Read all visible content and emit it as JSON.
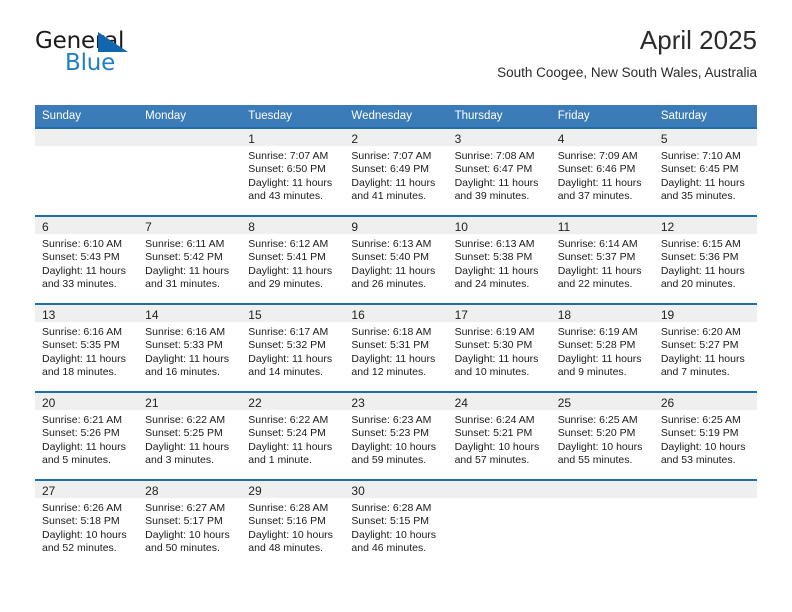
{
  "brand": {
    "name_top": "General",
    "name_bottom": "Blue",
    "triangle_color": "#1266ae",
    "blue_color": "#1f7fc4"
  },
  "header": {
    "title": "April 2025",
    "subtitle": "South Coogee, New South Wales, Australia"
  },
  "theme": {
    "header_row_bg": "#3b7cb8",
    "row_divider": "#1f6cb0",
    "daynum_band_bg": "#efefef"
  },
  "calendar": {
    "weekdays": [
      "Sunday",
      "Monday",
      "Tuesday",
      "Wednesday",
      "Thursday",
      "Friday",
      "Saturday"
    ],
    "weeks": [
      [
        {
          "day": "",
          "sunrise": "",
          "sunset": "",
          "daylight1": "",
          "daylight2": ""
        },
        {
          "day": "",
          "sunrise": "",
          "sunset": "",
          "daylight1": "",
          "daylight2": ""
        },
        {
          "day": "1",
          "sunrise": "Sunrise: 7:07 AM",
          "sunset": "Sunset: 6:50 PM",
          "daylight1": "Daylight: 11 hours",
          "daylight2": "and 43 minutes."
        },
        {
          "day": "2",
          "sunrise": "Sunrise: 7:07 AM",
          "sunset": "Sunset: 6:49 PM",
          "daylight1": "Daylight: 11 hours",
          "daylight2": "and 41 minutes."
        },
        {
          "day": "3",
          "sunrise": "Sunrise: 7:08 AM",
          "sunset": "Sunset: 6:47 PM",
          "daylight1": "Daylight: 11 hours",
          "daylight2": "and 39 minutes."
        },
        {
          "day": "4",
          "sunrise": "Sunrise: 7:09 AM",
          "sunset": "Sunset: 6:46 PM",
          "daylight1": "Daylight: 11 hours",
          "daylight2": "and 37 minutes."
        },
        {
          "day": "5",
          "sunrise": "Sunrise: 7:10 AM",
          "sunset": "Sunset: 6:45 PM",
          "daylight1": "Daylight: 11 hours",
          "daylight2": "and 35 minutes."
        }
      ],
      [
        {
          "day": "6",
          "sunrise": "Sunrise: 6:10 AM",
          "sunset": "Sunset: 5:43 PM",
          "daylight1": "Daylight: 11 hours",
          "daylight2": "and 33 minutes."
        },
        {
          "day": "7",
          "sunrise": "Sunrise: 6:11 AM",
          "sunset": "Sunset: 5:42 PM",
          "daylight1": "Daylight: 11 hours",
          "daylight2": "and 31 minutes."
        },
        {
          "day": "8",
          "sunrise": "Sunrise: 6:12 AM",
          "sunset": "Sunset: 5:41 PM",
          "daylight1": "Daylight: 11 hours",
          "daylight2": "and 29 minutes."
        },
        {
          "day": "9",
          "sunrise": "Sunrise: 6:13 AM",
          "sunset": "Sunset: 5:40 PM",
          "daylight1": "Daylight: 11 hours",
          "daylight2": "and 26 minutes."
        },
        {
          "day": "10",
          "sunrise": "Sunrise: 6:13 AM",
          "sunset": "Sunset: 5:38 PM",
          "daylight1": "Daylight: 11 hours",
          "daylight2": "and 24 minutes."
        },
        {
          "day": "11",
          "sunrise": "Sunrise: 6:14 AM",
          "sunset": "Sunset: 5:37 PM",
          "daylight1": "Daylight: 11 hours",
          "daylight2": "and 22 minutes."
        },
        {
          "day": "12",
          "sunrise": "Sunrise: 6:15 AM",
          "sunset": "Sunset: 5:36 PM",
          "daylight1": "Daylight: 11 hours",
          "daylight2": "and 20 minutes."
        }
      ],
      [
        {
          "day": "13",
          "sunrise": "Sunrise: 6:16 AM",
          "sunset": "Sunset: 5:35 PM",
          "daylight1": "Daylight: 11 hours",
          "daylight2": "and 18 minutes."
        },
        {
          "day": "14",
          "sunrise": "Sunrise: 6:16 AM",
          "sunset": "Sunset: 5:33 PM",
          "daylight1": "Daylight: 11 hours",
          "daylight2": "and 16 minutes."
        },
        {
          "day": "15",
          "sunrise": "Sunrise: 6:17 AM",
          "sunset": "Sunset: 5:32 PM",
          "daylight1": "Daylight: 11 hours",
          "daylight2": "and 14 minutes."
        },
        {
          "day": "16",
          "sunrise": "Sunrise: 6:18 AM",
          "sunset": "Sunset: 5:31 PM",
          "daylight1": "Daylight: 11 hours",
          "daylight2": "and 12 minutes."
        },
        {
          "day": "17",
          "sunrise": "Sunrise: 6:19 AM",
          "sunset": "Sunset: 5:30 PM",
          "daylight1": "Daylight: 11 hours",
          "daylight2": "and 10 minutes."
        },
        {
          "day": "18",
          "sunrise": "Sunrise: 6:19 AM",
          "sunset": "Sunset: 5:28 PM",
          "daylight1": "Daylight: 11 hours",
          "daylight2": "and 9 minutes."
        },
        {
          "day": "19",
          "sunrise": "Sunrise: 6:20 AM",
          "sunset": "Sunset: 5:27 PM",
          "daylight1": "Daylight: 11 hours",
          "daylight2": "and 7 minutes."
        }
      ],
      [
        {
          "day": "20",
          "sunrise": "Sunrise: 6:21 AM",
          "sunset": "Sunset: 5:26 PM",
          "daylight1": "Daylight: 11 hours",
          "daylight2": "and 5 minutes."
        },
        {
          "day": "21",
          "sunrise": "Sunrise: 6:22 AM",
          "sunset": "Sunset: 5:25 PM",
          "daylight1": "Daylight: 11 hours",
          "daylight2": "and 3 minutes."
        },
        {
          "day": "22",
          "sunrise": "Sunrise: 6:22 AM",
          "sunset": "Sunset: 5:24 PM",
          "daylight1": "Daylight: 11 hours",
          "daylight2": "and 1 minute."
        },
        {
          "day": "23",
          "sunrise": "Sunrise: 6:23 AM",
          "sunset": "Sunset: 5:23 PM",
          "daylight1": "Daylight: 10 hours",
          "daylight2": "and 59 minutes."
        },
        {
          "day": "24",
          "sunrise": "Sunrise: 6:24 AM",
          "sunset": "Sunset: 5:21 PM",
          "daylight1": "Daylight: 10 hours",
          "daylight2": "and 57 minutes."
        },
        {
          "day": "25",
          "sunrise": "Sunrise: 6:25 AM",
          "sunset": "Sunset: 5:20 PM",
          "daylight1": "Daylight: 10 hours",
          "daylight2": "and 55 minutes."
        },
        {
          "day": "26",
          "sunrise": "Sunrise: 6:25 AM",
          "sunset": "Sunset: 5:19 PM",
          "daylight1": "Daylight: 10 hours",
          "daylight2": "and 53 minutes."
        }
      ],
      [
        {
          "day": "27",
          "sunrise": "Sunrise: 6:26 AM",
          "sunset": "Sunset: 5:18 PM",
          "daylight1": "Daylight: 10 hours",
          "daylight2": "and 52 minutes."
        },
        {
          "day": "28",
          "sunrise": "Sunrise: 6:27 AM",
          "sunset": "Sunset: 5:17 PM",
          "daylight1": "Daylight: 10 hours",
          "daylight2": "and 50 minutes."
        },
        {
          "day": "29",
          "sunrise": "Sunrise: 6:28 AM",
          "sunset": "Sunset: 5:16 PM",
          "daylight1": "Daylight: 10 hours",
          "daylight2": "and 48 minutes."
        },
        {
          "day": "30",
          "sunrise": "Sunrise: 6:28 AM",
          "sunset": "Sunset: 5:15 PM",
          "daylight1": "Daylight: 10 hours",
          "daylight2": "and 46 minutes."
        },
        {
          "day": "",
          "sunrise": "",
          "sunset": "",
          "daylight1": "",
          "daylight2": ""
        },
        {
          "day": "",
          "sunrise": "",
          "sunset": "",
          "daylight1": "",
          "daylight2": ""
        },
        {
          "day": "",
          "sunrise": "",
          "sunset": "",
          "daylight1": "",
          "daylight2": ""
        }
      ]
    ]
  }
}
